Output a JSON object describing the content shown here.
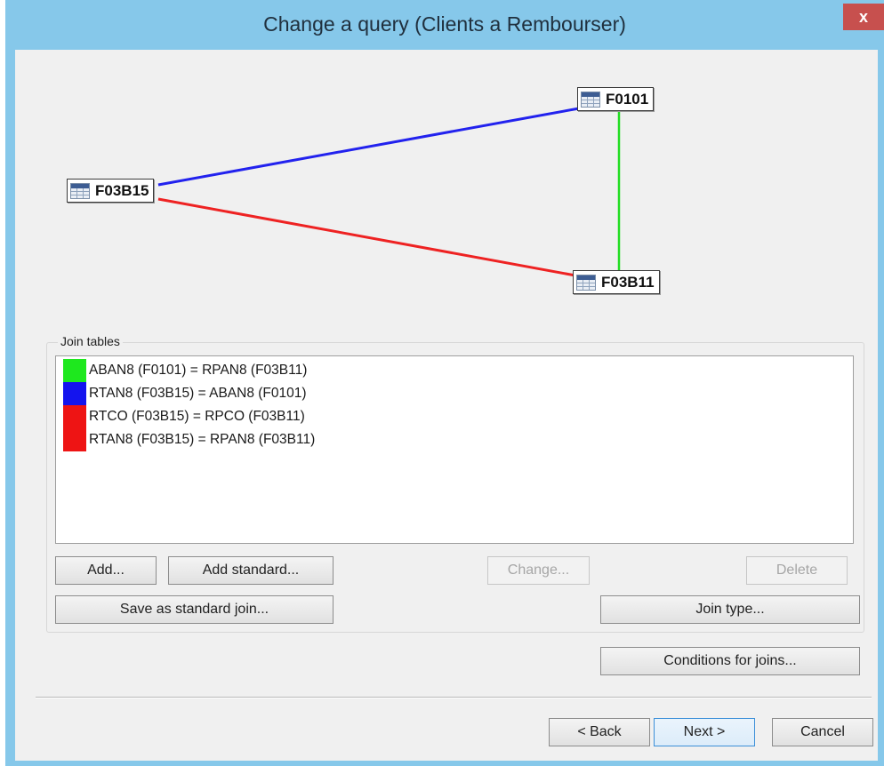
{
  "window": {
    "title": "Change a query (Clients a Rembourser)",
    "close_label": "x"
  },
  "diagram": {
    "tables": [
      "F0101",
      "F03B15",
      "F03B11"
    ],
    "links": [
      {
        "from": "F0101",
        "to": "F03B11",
        "color": "#22dd22"
      },
      {
        "from": "F03B15",
        "to": "F0101",
        "color": "#2222ee"
      },
      {
        "from": "F03B15",
        "to": "F03B11",
        "color": "#ee2222"
      }
    ]
  },
  "join_tables": {
    "label": "Join tables",
    "joins": [
      {
        "color": "#1ee81e",
        "text": "ABAN8 (F0101) = RPAN8 (F03B11)"
      },
      {
        "color": "#1414ee",
        "text": "RTAN8 (F03B15) = ABAN8 (F0101)"
      },
      {
        "color": "#ee1414",
        "text": "RTCO (F03B15) = RPCO (F03B11)"
      },
      {
        "color": "#ee1414",
        "text": "RTAN8 (F03B15) = RPAN8 (F03B11)"
      }
    ],
    "buttons": {
      "add": "Add...",
      "add_standard": "Add standard...",
      "change": "Change...",
      "delete": "Delete",
      "save_standard": "Save as standard join...",
      "join_type": "Join type..."
    }
  },
  "conditions_button": "Conditions for joins...",
  "footer": {
    "back": "< Back",
    "next": "Next >",
    "cancel": "Cancel"
  },
  "colors": {
    "titlebar": "#86c8ea",
    "dialog_bg": "#f0f0f0",
    "close": "#c7504e"
  }
}
